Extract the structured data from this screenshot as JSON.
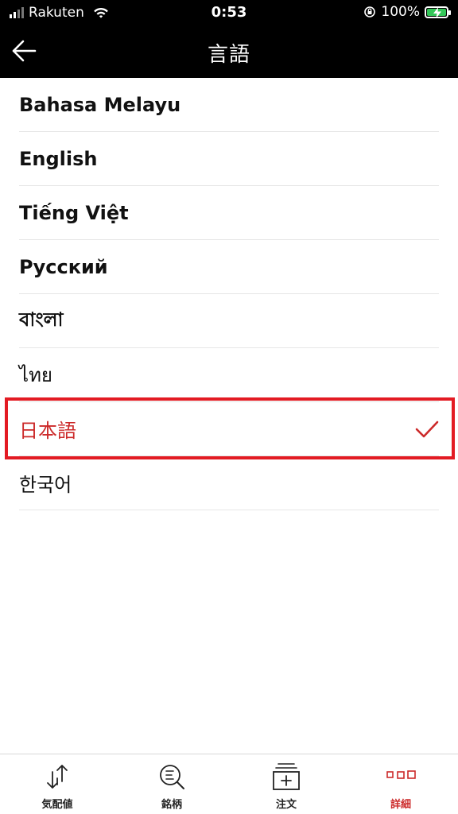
{
  "status_bar": {
    "carrier": "Rakuten",
    "time": "0:53",
    "battery_percent": "100%"
  },
  "header": {
    "title": "言語"
  },
  "languages": [
    {
      "label": "Bahasa Melayu",
      "selected": false
    },
    {
      "label": "English",
      "selected": false
    },
    {
      "label": "Tiếng Việt",
      "selected": false
    },
    {
      "label": "Русский",
      "selected": false
    },
    {
      "label": "বাংলা",
      "selected": false
    },
    {
      "label": "ไทย",
      "selected": false
    },
    {
      "label": "日本語",
      "selected": true
    },
    {
      "label": "한국어",
      "selected": false
    }
  ],
  "tabs": [
    {
      "label": "気配値",
      "icon": "quote-arrows-icon"
    },
    {
      "label": "銘柄",
      "icon": "search-list-icon"
    },
    {
      "label": "注文",
      "icon": "order-add-icon"
    },
    {
      "label": "詳細",
      "icon": "more-dots-icon",
      "active": true
    }
  ],
  "colors": {
    "accent": "#cc2a2a",
    "highlight": "#e31b23",
    "header_bg": "#000000",
    "battery": "#34c759"
  }
}
